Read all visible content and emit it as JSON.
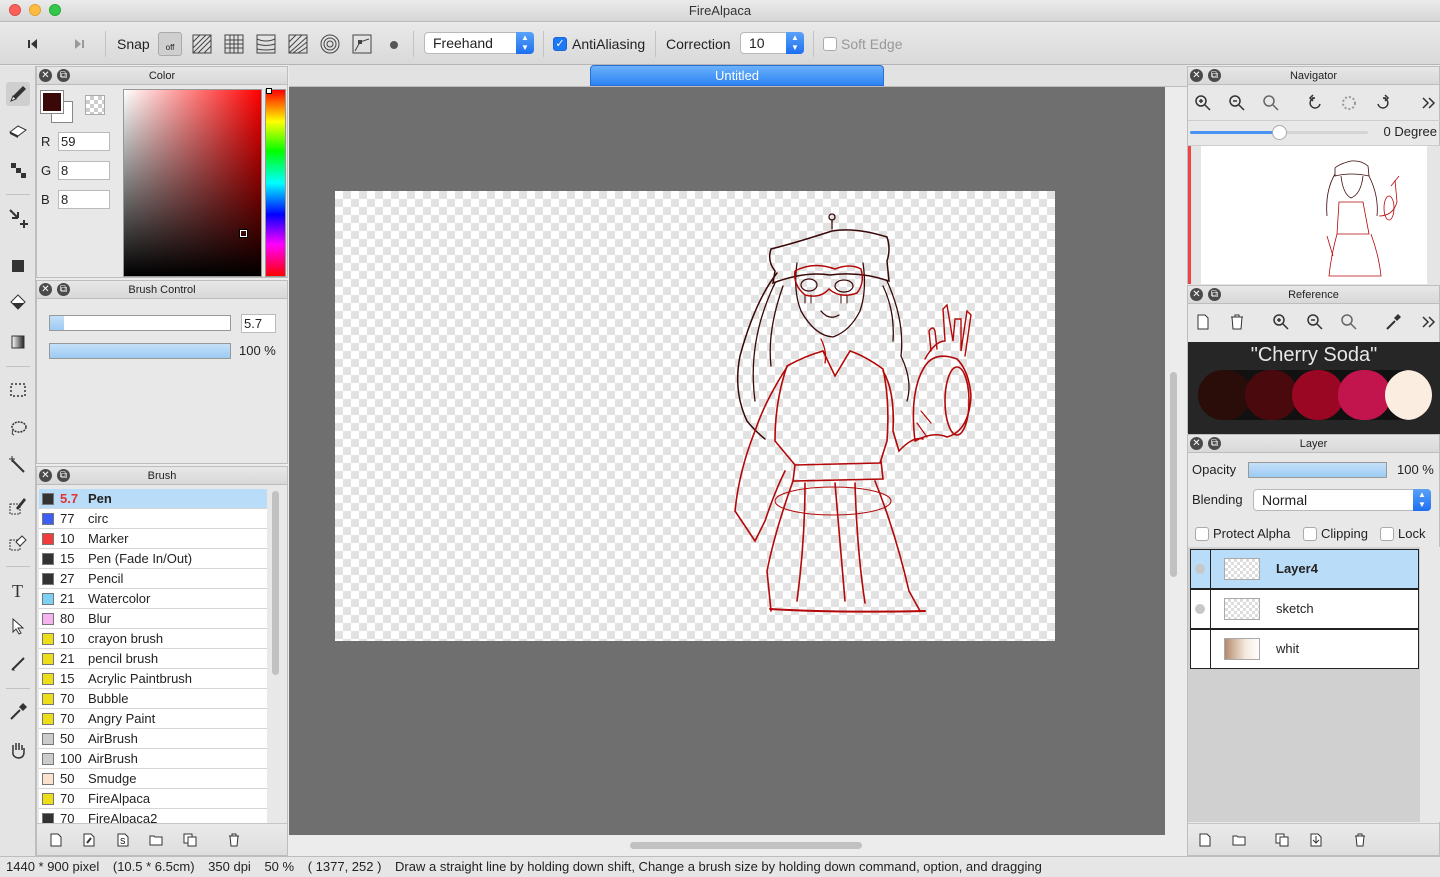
{
  "window": {
    "title": "FireAlpaca"
  },
  "toolbar": {
    "snap_label": "Snap",
    "snap_off_label": "off",
    "draw_mode": "Freehand",
    "antialiasing_label": "AntiAliasing",
    "antialiasing_checked": true,
    "correction_label": "Correction",
    "correction_value": "10",
    "soft_edge_label": "Soft Edge",
    "soft_edge_checked": false
  },
  "color_panel": {
    "title": "Color",
    "r_label": "R",
    "r_value": "59",
    "g_label": "G",
    "g_value": "8",
    "b_label": "B",
    "b_value": "8",
    "foreground": "#3b0808",
    "background": "#ffffff"
  },
  "brush_control": {
    "title": "Brush Control",
    "size_value": "5.7",
    "opacity_value": "100 %",
    "size_fraction": 0.08,
    "opacity_fraction": 1.0
  },
  "brush_panel": {
    "title": "Brush",
    "items": [
      {
        "size": "5.7",
        "name": "Pen",
        "color": "#333333"
      },
      {
        "size": "77",
        "name": "circ",
        "color": "#3e5df2"
      },
      {
        "size": "10",
        "name": "Marker",
        "color": "#f23b3b"
      },
      {
        "size": "15",
        "name": "Pen (Fade In/Out)",
        "color": "#333333"
      },
      {
        "size": "27",
        "name": "Pencil",
        "color": "#333333"
      },
      {
        "size": "21",
        "name": "Watercolor",
        "color": "#7cd0f5"
      },
      {
        "size": "80",
        "name": "Blur",
        "color": "#f5b3f0"
      },
      {
        "size": "10",
        "name": "crayon brush",
        "color": "#eedc19"
      },
      {
        "size": "21",
        "name": "pencil brush",
        "color": "#eedc19"
      },
      {
        "size": "15",
        "name": "Acrylic Paintbrush",
        "color": "#eedc19"
      },
      {
        "size": "70",
        "name": "Bubble",
        "color": "#eedc19"
      },
      {
        "size": "70",
        "name": "Angry Paint",
        "color": "#eedc19"
      },
      {
        "size": "50",
        "name": "AirBrush",
        "color": "#cccccc"
      },
      {
        "size": "100",
        "name": "AirBrush",
        "color": "#cccccc"
      },
      {
        "size": "50",
        "name": "Smudge",
        "color": "#fbe2cf"
      },
      {
        "size": "70",
        "name": "FireAlpaca",
        "color": "#eedc19"
      },
      {
        "size": "70",
        "name": "FireAlpaca2",
        "color": "#333333"
      }
    ]
  },
  "canvas": {
    "document_tab": "Untitled"
  },
  "navigator": {
    "title": "Navigator",
    "rotation": "0 Degree"
  },
  "reference": {
    "title": "Reference",
    "palette_title": "\"Cherry Soda\"",
    "palette_colors": [
      "#2a0d09",
      "#4a0a0d",
      "#9a0722",
      "#c2154e",
      "#fbeee0"
    ]
  },
  "layer_panel": {
    "title": "Layer",
    "opacity_label": "Opacity",
    "opacity_value": "100 %",
    "blending_label": "Blending",
    "blending_value": "Normal",
    "protect_alpha_label": "Protect Alpha",
    "clipping_label": "Clipping",
    "lock_label": "Lock",
    "layers": [
      {
        "name": "Layer4",
        "selected": true
      },
      {
        "name": "sketch",
        "selected": false
      },
      {
        "name": "whit",
        "selected": false
      }
    ]
  },
  "status": {
    "size_px": "1440 * 900 pixel",
    "size_cm": "(10.5 * 6.5cm)",
    "dpi": "350 dpi",
    "zoom": "50 %",
    "cursor": "( 1377, 252 )",
    "hint": "Draw a straight line by holding down shift, Change a brush size by holding down command, option, and dragging"
  }
}
